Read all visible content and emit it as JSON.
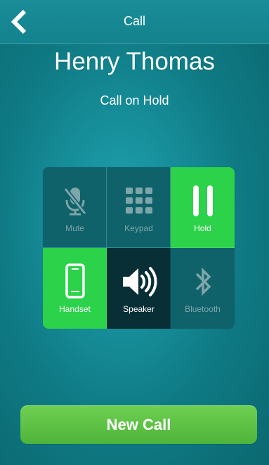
{
  "header": {
    "title": "Call",
    "back_icon": "back-chevron-icon"
  },
  "call": {
    "caller_name": "Henry Thomas",
    "status": "Call on Hold"
  },
  "controls": [
    {
      "label": "Mute",
      "icon": "muted-microphone-icon",
      "state": "inactive"
    },
    {
      "label": "Keypad",
      "icon": "keypad-icon",
      "state": "inactive"
    },
    {
      "label": "Hold",
      "icon": "pause-icon",
      "state": "active"
    },
    {
      "label": "Handset",
      "icon": "smartphone-icon",
      "state": "active"
    },
    {
      "label": "Speaker",
      "icon": "speaker-icon",
      "state": "selected"
    },
    {
      "label": "Bluetooth",
      "icon": "bluetooth-icon",
      "state": "inactive"
    }
  ],
  "actions": {
    "new_call_label": "New Call"
  },
  "colors": {
    "background": "#168f9a",
    "active_green": "#2bd24a",
    "selected_dark": "#072f35",
    "button_green": "#5cc545"
  }
}
